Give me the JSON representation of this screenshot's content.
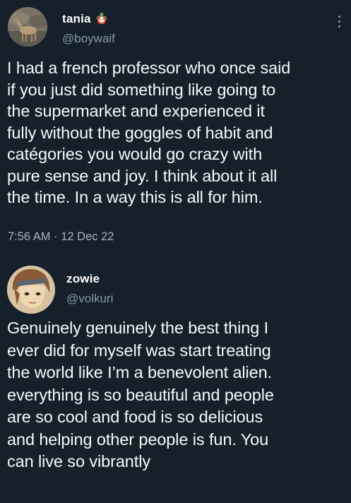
{
  "tweets": [
    {
      "name": "tania",
      "badge_emoji": "🪆",
      "handle": "@boywaif",
      "body_lines": [
        "I had a french professor who once said",
        "if you just did something like going to",
        "the supermarket and experienced it",
        "fully without the goggles of habit and",
        "catégories you would go crazy with",
        "pure sense and joy. I think about it all",
        "the time. In a way this is all for him."
      ],
      "time": "7:56 AM",
      "separator": "·",
      "date": "12 Dec 22",
      "avatar_icon": "deer-photo-avatar"
    },
    {
      "name": "zowie",
      "handle": "@volkuri",
      "body_lines": [
        "Genuinely genuinely the best thing I",
        "ever did for myself was start treating",
        "the world like I’m a benevolent alien.",
        "everything is so beautiful and people",
        "are so cool and food is so delicious",
        "and helping other people is fun. You",
        "can live so vibrantly"
      ],
      "avatar_icon": "anime-character-avatar"
    }
  ],
  "more_icon": "more-options-vertical-dots-icon",
  "colors": {
    "background": "#15202b",
    "secondary_text": "#8899a6",
    "primary_text": "#ffffff"
  }
}
